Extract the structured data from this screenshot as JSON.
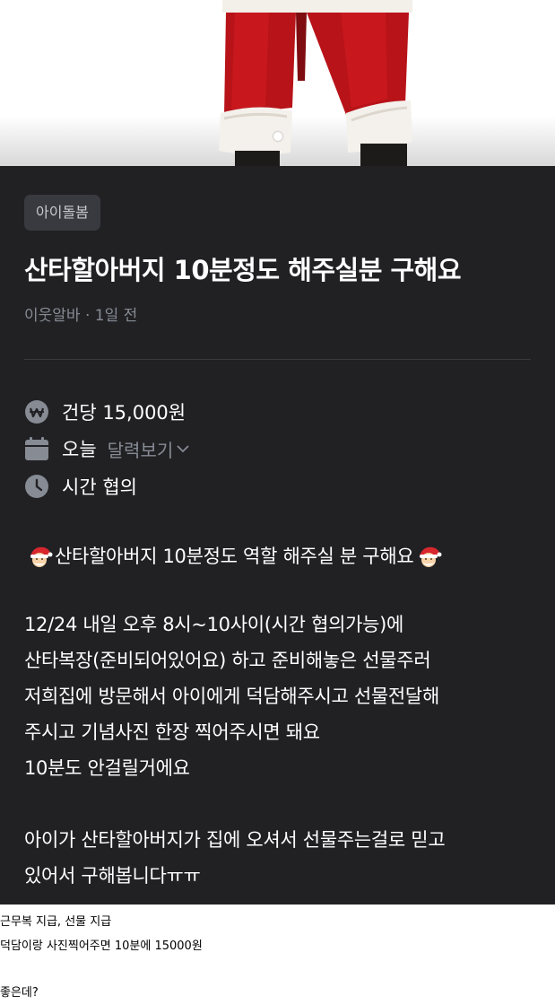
{
  "category": "아이돌봄",
  "title": "산타할아버지 10분정도 해주실분 구해요",
  "meta": "이웃알바 · 1일 전",
  "info": {
    "pay": "건당 15,000원",
    "date": "오늘",
    "calendar_link": "달력보기",
    "time": "시간 협의"
  },
  "body": {
    "headline": "산타할아버지 10분정도 역할 해주실 분 구해요",
    "lines": [
      "12/24 내일 오후 8시~10사이(시간 협의가능)에",
      "산타복장(준비되어있어요) 하고 준비해놓은 선물주러",
      "저희집에 방문해서 아이에게 덕담해주시고 선물전달해",
      "주시고 기념사진 한장 찍어주시면 돼요",
      "10분도 안걸릴거에요"
    ],
    "closing": [
      "아이가 산타할아버지가 집에 오셔서 선물주는걸로 믿고",
      "있어서 구해봅니다ㅠㅠ"
    ]
  },
  "caption": {
    "line1": "근무복 지급, 선물 지급",
    "line2": "덕담이랑 사진찍어주면 10분에 15000원",
    "line3": "좋은데?"
  },
  "icons": {
    "pay": "won-coin-icon",
    "date": "calendar-icon",
    "time": "clock-icon",
    "emoji": "santa-emoji-icon"
  },
  "colors": {
    "panel_bg": "#212124",
    "chip_bg": "#393a40",
    "muted_text": "#868b94",
    "santa_red": "#c8141b"
  }
}
